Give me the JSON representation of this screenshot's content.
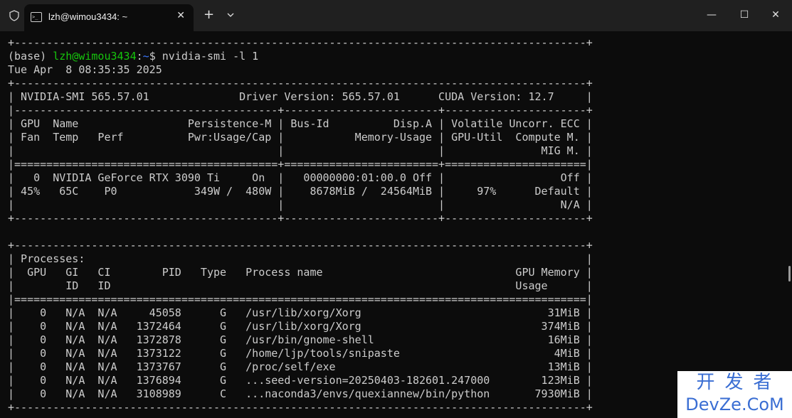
{
  "window": {
    "tab_title": "lzh@wimou3434: ~",
    "tab_close": "✕",
    "new_tab": "+",
    "minimize": "—",
    "maximize": "☐",
    "close": "✕"
  },
  "terminal": {
    "prompt_env": "(base) ",
    "prompt_user": "lzh@wimou3434",
    "prompt_sep": ":",
    "prompt_path": "~",
    "prompt_end": "$ ",
    "command": "nvidia-smi -l 1",
    "output": "Tue Apr  8 08:35:35 2025\n+-----------------------------------------------------------------------------------------+\n| NVIDIA-SMI 565.57.01              Driver Version: 565.57.01      CUDA Version: 12.7     |\n|-----------------------------------------+------------------------+----------------------+\n| GPU  Name                 Persistence-M | Bus-Id          Disp.A | Volatile Uncorr. ECC |\n| Fan  Temp   Perf          Pwr:Usage/Cap |           Memory-Usage | GPU-Util  Compute M. |\n|                                         |                        |               MIG M. |\n|=========================================+========================+======================|\n|   0  NVIDIA GeForce RTX 3090 Ti     On  |   00000000:01:00.0 Off |                  Off |\n| 45%   65C    P0            349W /  480W |    8678MiB /  24564MiB |     97%      Default |\n|                                         |                        |                  N/A |\n+-----------------------------------------+------------------------+----------------------+\n\n+-----------------------------------------------------------------------------------------+\n| Processes:                                                                              |\n|  GPU   GI   CI        PID   Type   Process name                              GPU Memory |\n|        ID   ID                                                               Usage      |\n|=========================================================================================|\n|    0   N/A  N/A     45058      G   /usr/lib/xorg/Xorg                             31MiB |\n|    0   N/A  N/A   1372464      G   /usr/lib/xorg/Xorg                            374MiB |\n|    0   N/A  N/A   1372878      G   /usr/bin/gnome-shell                           16MiB |\n|    0   N/A  N/A   1373122      G   /home/ljp/tools/snipaste                        4MiB |\n|    0   N/A  N/A   1373767      G   /proc/self/exe                                 13MiB |\n|    0   N/A  N/A   1376894      G   ...seed-version=20250403-182601.247000        123MiB |\n|    0   N/A  N/A   3108989      C   ...naconda3/envs/quexiannew/bin/python       7930MiB |\n+-----------------------------------------------------------------------------------------+"
  },
  "top_border": "+-----------------------------------------------------------------------------------------+",
  "watermark": {
    "cn": "开发者",
    "en": "DevZe.CoM"
  }
}
